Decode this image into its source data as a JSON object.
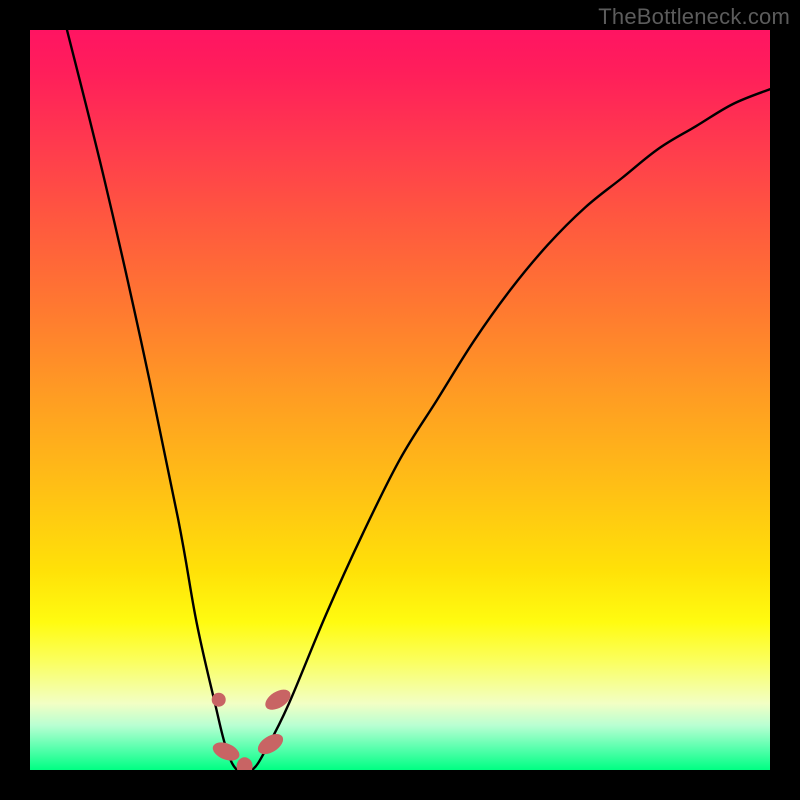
{
  "watermark": "TheBottleneck.com",
  "colors": {
    "page_bg": "#000000",
    "gradient_top": "#ff1462",
    "gradient_mid": "#ffc015",
    "gradient_bottom": "#00ff83",
    "curve_stroke": "#000000",
    "marker": "#c86464",
    "watermark_text": "#5c5c5c"
  },
  "chart_data": {
    "type": "line",
    "title": "",
    "xlabel": "",
    "ylabel": "",
    "xlim": [
      0,
      100
    ],
    "ylim": [
      0,
      100
    ],
    "series": [
      {
        "name": "bottleneck-curve",
        "x": [
          5,
          10,
          15,
          20,
          22.5,
          25,
          26.5,
          28,
          30,
          32,
          35,
          40,
          45,
          50,
          55,
          60,
          65,
          70,
          75,
          80,
          85,
          90,
          95,
          100
        ],
        "y": [
          100,
          80,
          58,
          34,
          20,
          9,
          3,
          0,
          0,
          3,
          9,
          21,
          32,
          42,
          50,
          58,
          65,
          71,
          76,
          80,
          84,
          87,
          90,
          92
        ]
      }
    ],
    "annotations": [
      {
        "name": "min-left-dot",
        "x": 25.5,
        "y": 9.5
      },
      {
        "name": "min-left-blob",
        "x": 26.5,
        "y": 2.5
      },
      {
        "name": "min-floor-blob",
        "x": 29.0,
        "y": 0.5
      },
      {
        "name": "min-right-blob",
        "x": 32.5,
        "y": 3.5
      },
      {
        "name": "min-right-top",
        "x": 33.5,
        "y": 9.5
      }
    ],
    "notes": "V-shaped bottleneck curve over a red→yellow→green vertical gradient; minimum near x≈28−30 where y≈0. Markers cluster around the floor of the V."
  }
}
